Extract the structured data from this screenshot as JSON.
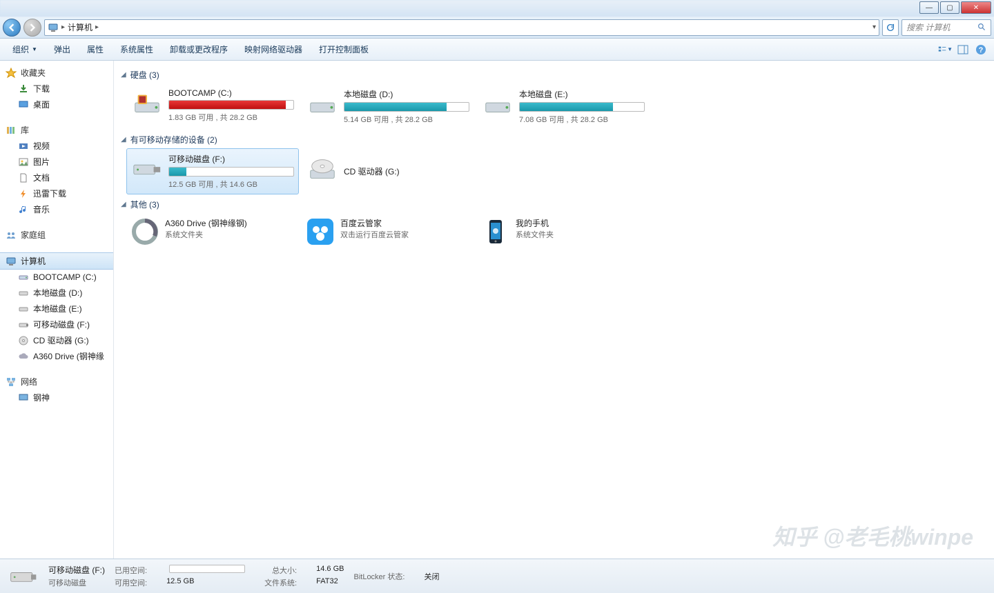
{
  "window": {
    "title": "计算机"
  },
  "nav": {
    "breadcrumb": [
      "计算机"
    ],
    "search_placeholder": "搜索 计算机"
  },
  "toolbar": {
    "items": [
      "组织",
      "弹出",
      "属性",
      "系统属性",
      "卸载或更改程序",
      "映射网络驱动器",
      "打开控制面板"
    ]
  },
  "sidebar": {
    "favorites": {
      "label": "收藏夹",
      "items": [
        "下载",
        "桌面"
      ]
    },
    "libraries": {
      "label": "库",
      "items": [
        "视频",
        "图片",
        "文档",
        "迅雷下载",
        "音乐"
      ]
    },
    "homegroup": {
      "label": "家庭组"
    },
    "computer": {
      "label": "计算机",
      "items": [
        "BOOTCAMP (C:)",
        "本地磁盘 (D:)",
        "本地磁盘 (E:)",
        "可移动磁盘 (F:)",
        "CD 驱动器 (G:)",
        "A360 Drive (钢神缘"
      ]
    },
    "network": {
      "label": "网络",
      "items": [
        "钢神"
      ]
    }
  },
  "content": {
    "hdd": {
      "title": "硬盘 (3)",
      "drives": [
        {
          "name": "BOOTCAMP (C:)",
          "free": "1.83 GB 可用 , 共 28.2 GB",
          "pct": 94,
          "color": "red"
        },
        {
          "name": "本地磁盘 (D:)",
          "free": "5.14 GB 可用 , 共 28.2 GB",
          "pct": 82,
          "color": "teal"
        },
        {
          "name": "本地磁盘 (E:)",
          "free": "7.08 GB 可用 , 共 28.2 GB",
          "pct": 75,
          "color": "teal"
        }
      ]
    },
    "removable": {
      "title": "有可移动存储的设备 (2)",
      "drives": [
        {
          "name": "可移动磁盘 (F:)",
          "free": "12.5 GB 可用 , 共 14.6 GB",
          "pct": 14,
          "color": "teal",
          "selected": true
        },
        {
          "name": "CD 驱动器 (G:)",
          "free": "",
          "pct": 0,
          "cd": true
        }
      ]
    },
    "other": {
      "title": "其他 (3)",
      "items": [
        {
          "name": "A360 Drive (钢神缘钢)",
          "sub": "系统文件夹",
          "icon": "a360"
        },
        {
          "name": "百度云管家",
          "sub": "双击运行百度云管家",
          "icon": "baidu"
        },
        {
          "name": "我的手机",
          "sub": "系统文件夹",
          "icon": "phone"
        }
      ]
    }
  },
  "status": {
    "name": "可移动磁盘 (F:)",
    "type": "可移动磁盘",
    "used_label": "已用空间:",
    "used_pct": 14,
    "avail_label": "可用空间:",
    "avail": "12.5 GB",
    "total_label": "总大小:",
    "total": "14.6 GB",
    "fs_label": "文件系统:",
    "fs": "FAT32",
    "bitlocker_label": "BitLocker 状态:",
    "bitlocker": "关闭"
  },
  "watermark": "知乎 @老毛桃winpe"
}
